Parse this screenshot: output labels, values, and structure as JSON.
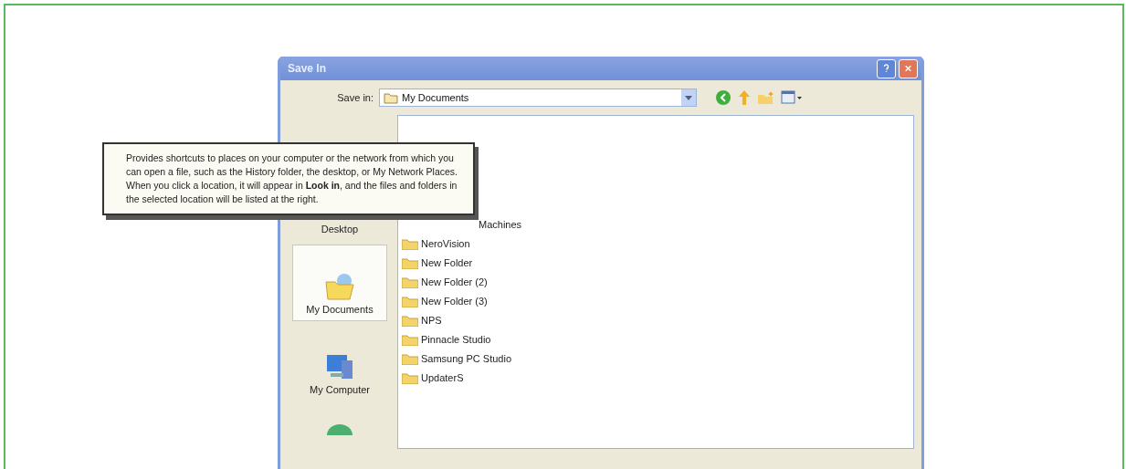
{
  "window": {
    "title": "Save In"
  },
  "toolbar": {
    "label": "Save in:",
    "location": "My Documents"
  },
  "places": [
    {
      "label": "Desktop",
      "kind": "desktop",
      "selected": false
    },
    {
      "label": "My Documents",
      "kind": "documents",
      "selected": true
    },
    {
      "label": "My Computer",
      "kind": "computer",
      "selected": false
    },
    {
      "kind": "network",
      "selected": false
    }
  ],
  "files": [
    {
      "name": "Machines",
      "kind": "partial"
    },
    {
      "name": "NeroVision",
      "kind": "folder"
    },
    {
      "name": "New Folder",
      "kind": "folder"
    },
    {
      "name": "New Folder (2)",
      "kind": "folder"
    },
    {
      "name": "New Folder (3)",
      "kind": "folder"
    },
    {
      "name": "NPS",
      "kind": "folder"
    },
    {
      "name": "Pinnacle Studio",
      "kind": "folder"
    },
    {
      "name": "Samsung PC Studio",
      "kind": "folder"
    },
    {
      "name": "UpdaterS",
      "kind": "folder"
    }
  ],
  "tooltip": "Provides shortcuts to places on your computer or the network from which you can open a file, such as the History folder, the desktop, or My Network Places. When you click a location, it will appear in **Look in**, and the files and folders in the selected location will be listed at the right."
}
